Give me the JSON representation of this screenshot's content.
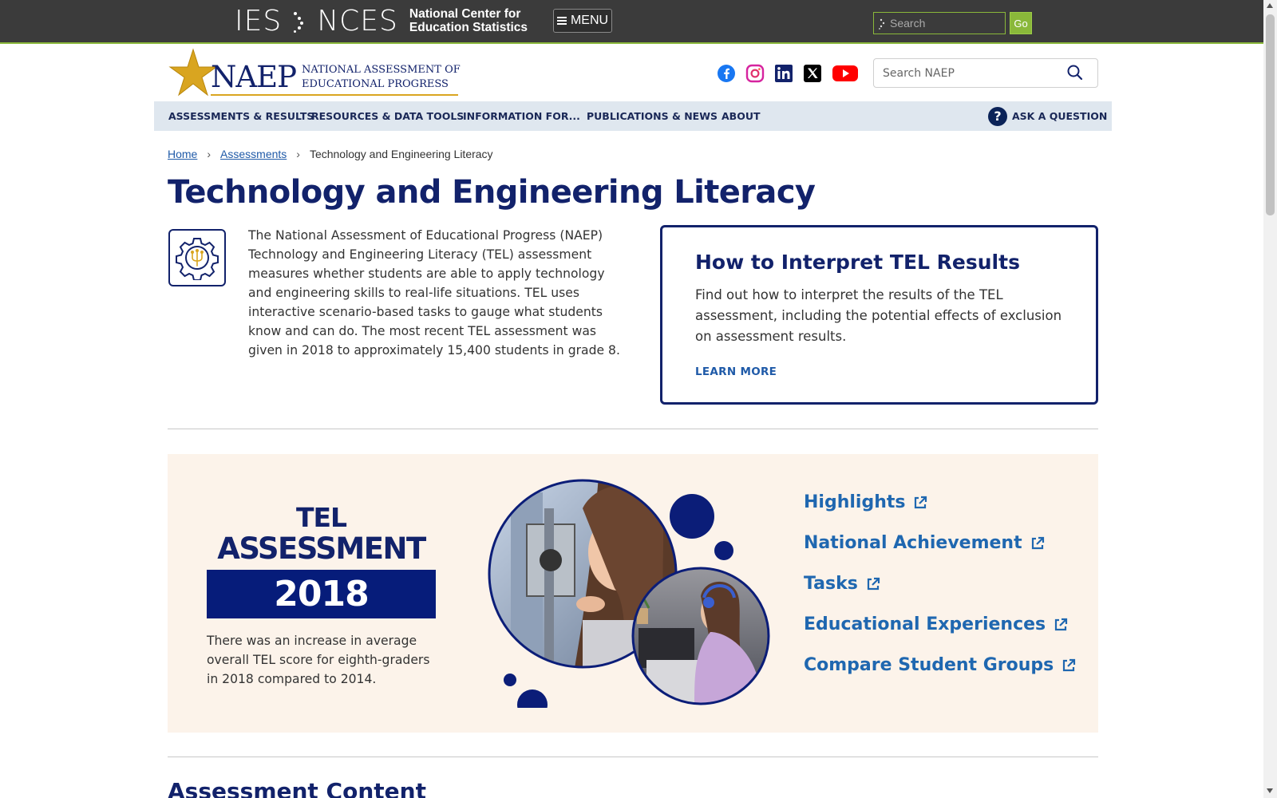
{
  "ies_bar": {
    "ies": "IES",
    "nces": "NCES",
    "nces_line1": "National Center for",
    "nces_line2": "Education Statistics",
    "menu_label": "MENU",
    "search_placeholder": "Search",
    "go_label": "Go"
  },
  "header": {
    "logo_naep": "NAEP",
    "logo_line1": "NATIONAL ASSESSMENT OF",
    "logo_line2": "EDUCATIONAL PROGRESS",
    "social": [
      "facebook-icon",
      "instagram-icon",
      "linkedin-icon",
      "x-icon",
      "youtube-icon"
    ],
    "search_placeholder": "Search NAEP"
  },
  "nav": {
    "items": [
      "ASSESSMENTS & RESULTS",
      "RESOURCES & DATA TOOLS",
      "INFORMATION FOR...",
      "PUBLICATIONS & NEWS",
      "ABOUT"
    ],
    "ask": "ASK A QUESTION"
  },
  "breadcrumb": {
    "home": "Home",
    "assessments": "Assessments",
    "current": "Technology and Engineering Literacy"
  },
  "page": {
    "title": "Technology and Engineering Literacy",
    "intro": "The National Assessment of Educational Progress (NAEP) Technology and Engineering Literacy (TEL) assessment measures whether students are able to apply technology and engineering skills to real-life situations. TEL uses interactive scenario-based tasks to gauge what students know and can do. The most recent TEL assessment was given in 2018 to approximately 15,400 students in grade 8."
  },
  "card": {
    "title": "How to Interpret TEL Results",
    "text": "Find out how to interpret the results of the TEL assessment, including the potential effects of exclusion on assessment results.",
    "link": "LEARN MORE"
  },
  "feature": {
    "line1": "TEL",
    "line2": "ASSESSMENT",
    "year": "2018",
    "text": "There was an increase in average overall TEL score for eighth-graders in 2018 compared to 2014.",
    "links": [
      "Highlights",
      "National Achievement",
      "Tasks",
      "Educational Experiences",
      "Compare Student Groups"
    ]
  },
  "section": {
    "title": "Assessment Content"
  },
  "colors": {
    "navy": "#12226b",
    "link_blue": "#1f67b0",
    "ies_bar": "#3b3b3b",
    "ies_green": "#8ab83a",
    "nav_bg": "#dfe7ef",
    "feature_bg": "#fcf3ea",
    "gold": "#d9a520"
  }
}
